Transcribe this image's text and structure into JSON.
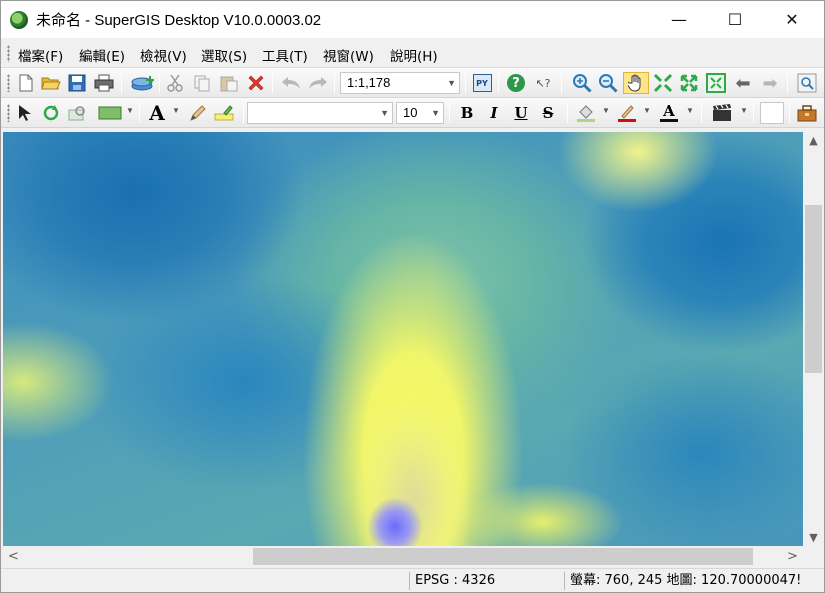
{
  "window": {
    "title": "未命名 - SuperGIS Desktop V10.0.0003.02",
    "minimize_glyph": "—",
    "maximize_glyph": "☐",
    "close_glyph": "✕"
  },
  "menu": [
    "檔案(F)",
    "編輯(E)",
    "檢視(V)",
    "選取(S)",
    "工具(T)",
    "視窗(W)",
    "說明(H)"
  ],
  "toolbar": {
    "scale_value": "1:1,178",
    "python_label": "PY",
    "help_glyph": "?",
    "whats_this_glyph": "↖?"
  },
  "draw_toolbar": {
    "font_name": "",
    "font_size": "10",
    "bold": "B",
    "italic": "I",
    "underline": "U",
    "strikethrough": "S",
    "text_tool": "A",
    "font_color_glyph": "A"
  },
  "colors": {
    "delete": "#e0392b",
    "zoom": "#2a7ab8",
    "pan_highlight": "#ffe58a",
    "extent": "#2fa94a",
    "line_color": "#cc1111"
  },
  "scroll": {
    "up": "▲",
    "down": "▼",
    "left": "<",
    "right": ">"
  },
  "status": {
    "crs": "EPSG : 4326",
    "coords": "螢幕: 760, 245  地圖: 120.70000047!"
  }
}
